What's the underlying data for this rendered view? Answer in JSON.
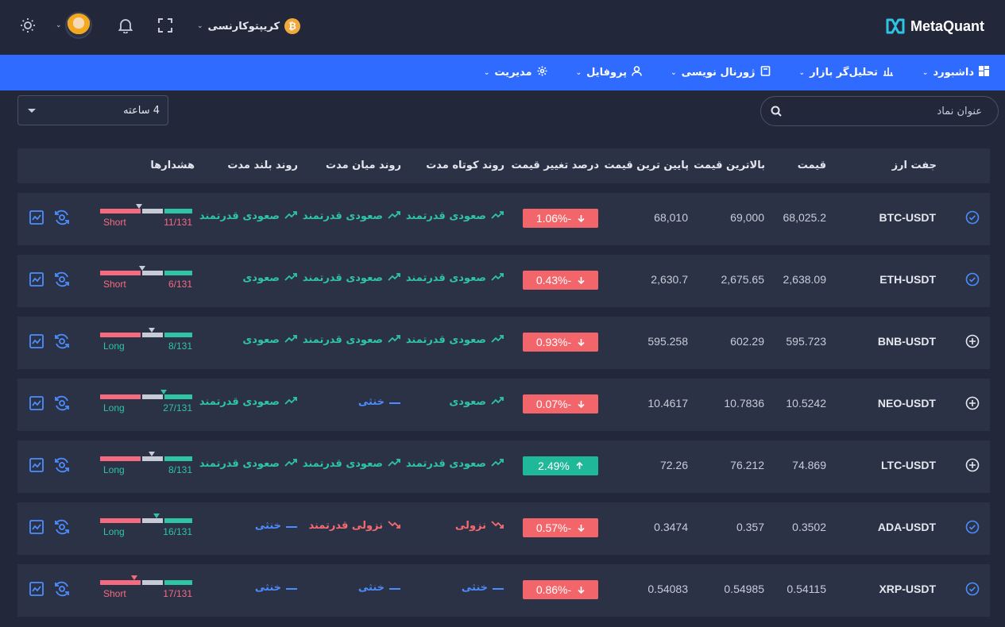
{
  "app": {
    "brand": "MetaQuant"
  },
  "topbar": {
    "market_label": "کریپتوکارنسی",
    "market_icon": "₿"
  },
  "nav": [
    {
      "label": "داشبورد",
      "icon": "dashboard-icon"
    },
    {
      "label": "تحلیل‌گر بازار",
      "icon": "bar-chart-icon"
    },
    {
      "label": "ژورنال نویسی",
      "icon": "book-icon"
    },
    {
      "label": "پروفایل",
      "icon": "user-icon"
    },
    {
      "label": "مدیریت",
      "icon": "gear-icon"
    }
  ],
  "search": {
    "placeholder": "عنوان نماد"
  },
  "timeframe": {
    "value": "4 ساعته"
  },
  "table": {
    "headers": {
      "pair": "جفت ارز",
      "price": "قیمت",
      "high": "بالاترین قیمت",
      "low": "پایین ترین قیمت",
      "change": "درصد تغییر قیمت",
      "short": "روند کوتاه مدت",
      "mid": "روند میان مدت",
      "long": "روند بلند مدت",
      "alerts": "هشدارها"
    },
    "rows": [
      {
        "pair": "BTC-USDT",
        "price": "68,025.2",
        "high": "69,000",
        "low": "68,010",
        "change": "1.06%-",
        "dir": "down",
        "short": "صعودی قدرتمند",
        "short_t": "up",
        "mid": "صعودی قدرتمند",
        "mid_t": "up",
        "long": "صعودی قدرتمند",
        "long_t": "up",
        "side": "Short",
        "count": "11/131",
        "marker": 0.42,
        "state": "check"
      },
      {
        "pair": "ETH-USDT",
        "price": "2,638.09",
        "high": "2,675.65",
        "low": "2,630.7",
        "change": "0.43%-",
        "dir": "down",
        "short": "صعودی قدرتمند",
        "short_t": "up",
        "mid": "صعودی قدرتمند",
        "mid_t": "up",
        "long": "صعودی",
        "long_t": "up",
        "side": "Short",
        "count": "6/131",
        "marker": 0.46,
        "state": "check"
      },
      {
        "pair": "BNB-USDT",
        "price": "595.723",
        "high": "602.29",
        "low": "595.258",
        "change": "0.93%-",
        "dir": "down",
        "short": "صعودی قدرتمند",
        "short_t": "up",
        "mid": "صعودی قدرتمند",
        "mid_t": "up",
        "long": "صعودی",
        "long_t": "up",
        "side": "Long",
        "count": "8/131",
        "marker": 0.56,
        "state": "plus"
      },
      {
        "pair": "NEO-USDT",
        "price": "10.5242",
        "high": "10.7836",
        "low": "10.4617",
        "change": "0.07%-",
        "dir": "down",
        "short": "صعودی",
        "short_t": "up",
        "mid": "خنثی",
        "mid_t": "flat",
        "long": "صعودی قدرتمند",
        "long_t": "up",
        "side": "Long",
        "count": "27/131",
        "marker": 0.69,
        "state": "plus"
      },
      {
        "pair": "LTC-USDT",
        "price": "74.869",
        "high": "76.212",
        "low": "72.26",
        "change": "2.49%",
        "dir": "up",
        "short": "صعودی قدرتمند",
        "short_t": "up",
        "mid": "صعودی قدرتمند",
        "mid_t": "up",
        "long": "صعودی قدرتمند",
        "long_t": "up",
        "side": "Long",
        "count": "8/131",
        "marker": 0.56,
        "state": "plus"
      },
      {
        "pair": "ADA-USDT",
        "price": "0.3502",
        "high": "0.357",
        "low": "0.3474",
        "change": "0.57%-",
        "dir": "down",
        "short": "نزولی",
        "short_t": "down",
        "mid": "نزولی قدرتمند",
        "mid_t": "down",
        "long": "خنثی",
        "long_t": "flat",
        "side": "Long",
        "count": "16/131",
        "marker": 0.61,
        "state": "check"
      },
      {
        "pair": "XRP-USDT",
        "price": "0.54115",
        "high": "0.54985",
        "low": "0.54083",
        "change": "0.86%-",
        "dir": "down",
        "short": "خنثی",
        "short_t": "flat",
        "mid": "خنثی",
        "mid_t": "flat",
        "long": "خنثی",
        "long_t": "flat",
        "side": "Short",
        "count": "17/131",
        "marker": 0.37,
        "state": "check"
      }
    ]
  },
  "colors": {
    "accent": "#2f6bff",
    "up": "#2ec4a4",
    "down": "#f46b70",
    "flat": "#4b8dff",
    "short_label": "#f46b80",
    "long_label": "#2ec4a4"
  }
}
